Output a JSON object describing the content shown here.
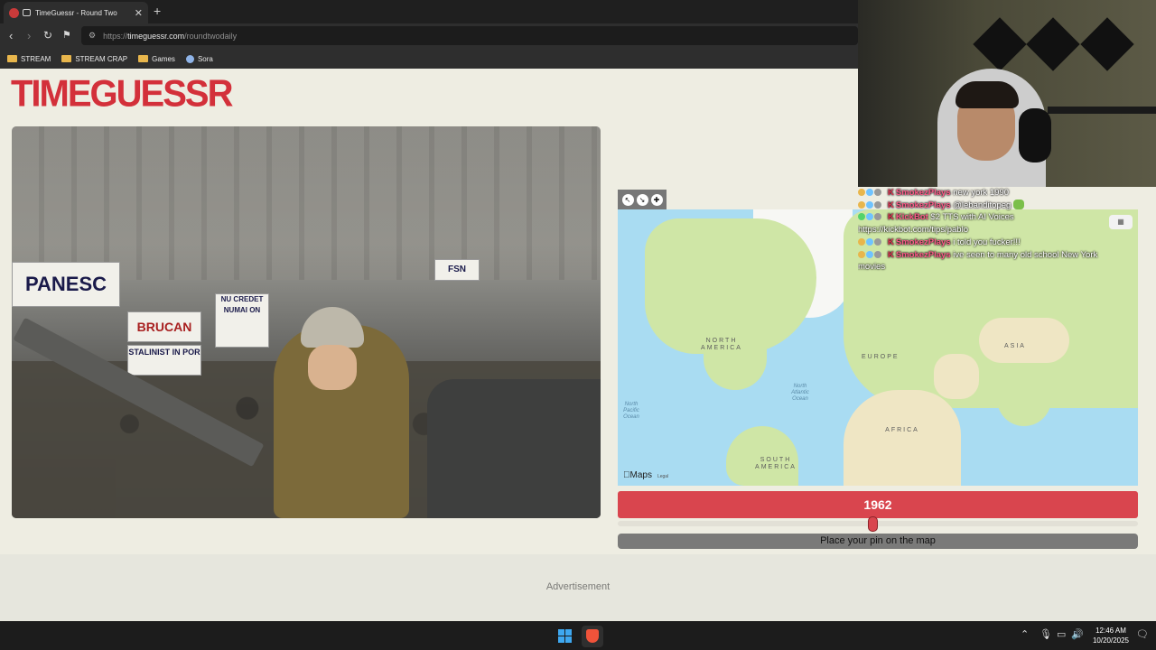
{
  "browser": {
    "tab_title": "TimeGuessr - Round Two",
    "url_prefix": "https://",
    "url_domain": "timeguessr.com",
    "url_path": "/roundtwodaily",
    "bookmarks": [
      {
        "label": "STREAM",
        "icon": "folder-icon"
      },
      {
        "label": "STREAM CRAP",
        "icon": "folder-icon"
      },
      {
        "label": "Games",
        "icon": "folder-icon"
      },
      {
        "label": "Sora",
        "icon": "sora-icon"
      }
    ]
  },
  "site": {
    "logo": "TIMEGUESSR",
    "brand_color": "#d3303a"
  },
  "photo": {
    "banners": [
      "PANESC",
      "BRUCAN",
      "STALINIST IN POR",
      "NU CREDET NUMAI ON",
      "FSN"
    ]
  },
  "map": {
    "labels": {
      "north_america": "NORTH\nAMERICA",
      "south_america": "SOUTH\nAMERICA",
      "europe": "EUROPE",
      "africa": "AFRICA",
      "asia": "ASIA",
      "north_atlantic": "North\nAtlantic\nOcean",
      "north_pacific": "North\nPacific\nOcean"
    },
    "provider": "Maps",
    "legal": "Legal"
  },
  "guess": {
    "year": "1962",
    "year_fraction": 0.49,
    "button_label": "Place your pin on the map"
  },
  "ad_label": "Advertisement",
  "chat": [
    {
      "user": "SmokezPlays",
      "message": "new york 1990"
    },
    {
      "user": "SmokezPlays",
      "message": "@lebanditopeg"
    },
    {
      "user": "KickBot",
      "message": "$2 TTS with AI Voices"
    },
    {
      "user": "",
      "message": "https://kickbot.com/tips/pablo"
    },
    {
      "user": "SmokezPlays",
      "message": "i told you fucker!!!"
    },
    {
      "user": "SmokezPlays",
      "message": "ive seen to many old school New York"
    },
    {
      "user": "",
      "message": "movies"
    }
  ],
  "taskbar": {
    "time": "12:46 AM",
    "date": "10/20/2025"
  }
}
